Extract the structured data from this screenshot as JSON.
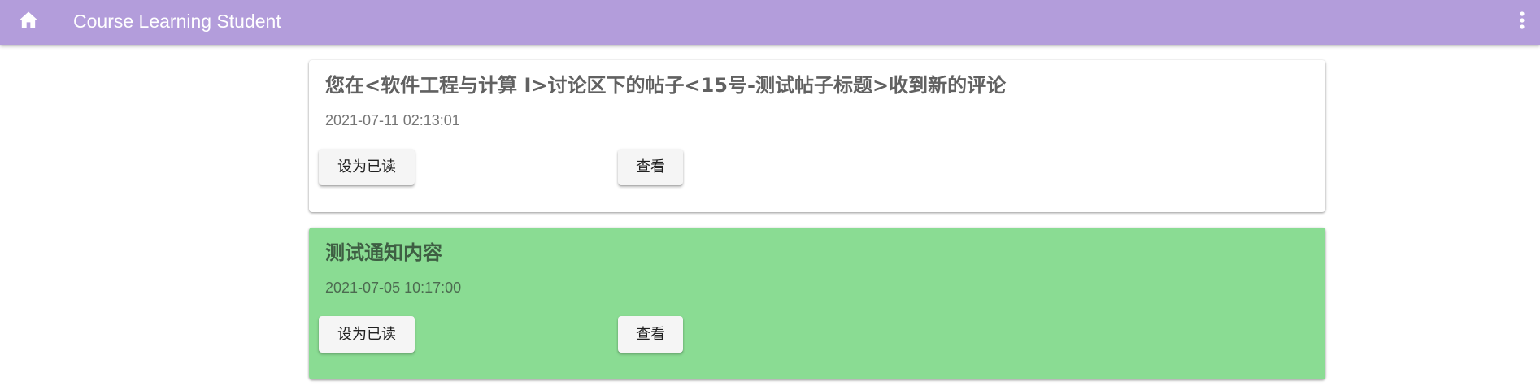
{
  "appbar": {
    "title": "Course Learning Student",
    "home_icon": "home-icon",
    "menu_icon": "more-vert-icon",
    "color": "#b39ddb"
  },
  "notifications": [
    {
      "title": "您在<软件工程与计算 I>讨论区下的帖子<15号-测试帖子标题>收到新的评论",
      "time": "2021-07-11 02:13:01",
      "mark_read_label": "设为已读",
      "view_label": "查看",
      "background": "#ffffff"
    },
    {
      "title": "测试通知内容",
      "time": "2021-07-05 10:17:00",
      "mark_read_label": "设为已读",
      "view_label": "查看",
      "background": "#8adc93"
    }
  ]
}
